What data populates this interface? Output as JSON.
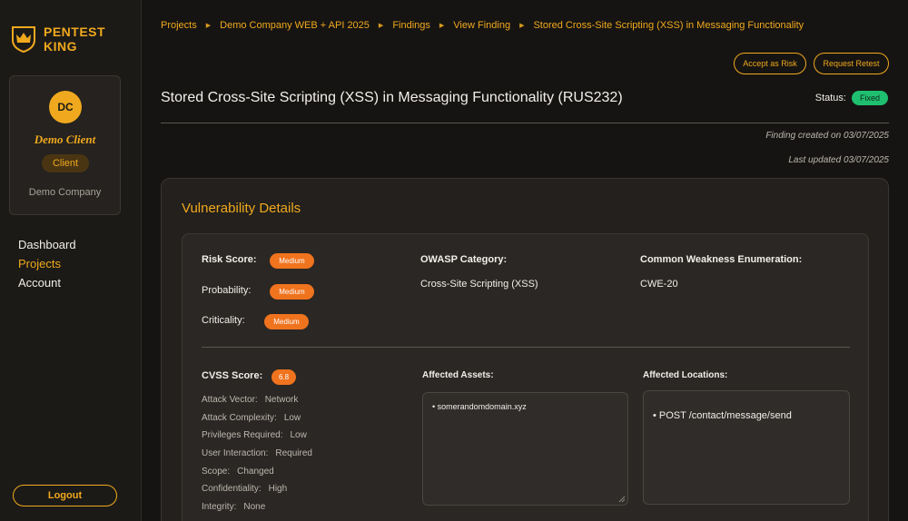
{
  "brand": {
    "line1": "PENTEST",
    "line2": "KING"
  },
  "profile": {
    "initials": "DC",
    "name": "Demo Client",
    "role": "Client",
    "company": "Demo Company"
  },
  "nav": [
    {
      "label": "Dashboard",
      "active": false
    },
    {
      "label": "Projects",
      "active": true
    },
    {
      "label": "Account",
      "active": false
    }
  ],
  "logout_label": "Logout",
  "breadcrumb": [
    "Projects",
    "Demo Company WEB + API 2025",
    "Findings",
    "View Finding",
    "Stored Cross-Site Scripting (XSS) in Messaging Functionality"
  ],
  "actions": {
    "accept_risk": "Accept as Risk",
    "request_retest": "Request Retest"
  },
  "finding": {
    "title": "Stored Cross-Site Scripting (XSS) in Messaging Functionality (RUS232)",
    "status_label": "Status:",
    "status": "Fixed",
    "created": "Finding created on 03/07/2025",
    "updated": "Last updated 03/07/2025"
  },
  "details": {
    "heading": "Vulnerability Details",
    "risk_score_label": "Risk Score:",
    "risk_score": "Medium",
    "probability_label": "Probability:",
    "probability": "Medium",
    "criticality_label": "Criticality:",
    "criticality": "Medium",
    "owasp_label": "OWASP Category:",
    "owasp": "Cross-Site Scripting (XSS)",
    "cwe_label": "Common Weakness Enumeration:",
    "cwe": "CWE-20",
    "cvss_label": "CVSS Score:",
    "cvss": "6.8",
    "cvss_items": [
      {
        "label": "Attack Vector:",
        "value": "Network"
      },
      {
        "label": "Attack Complexity:",
        "value": "Low"
      },
      {
        "label": "Privileges Required:",
        "value": "Low"
      },
      {
        "label": "User Interaction:",
        "value": "Required"
      },
      {
        "label": "Scope:",
        "value": "Changed"
      },
      {
        "label": "Confidentiality:",
        "value": "High"
      },
      {
        "label": "Integrity:",
        "value": "None"
      }
    ],
    "assets_label": "Affected Assets:",
    "assets": [
      "• somerandomdomain.xyz"
    ],
    "locations_label": "Affected Locations:",
    "locations": [
      "• POST /contact/message/send"
    ]
  },
  "colors": {
    "accent": "#f0a91e",
    "medium": "#f0731e",
    "fixed": "#1fbf70"
  }
}
